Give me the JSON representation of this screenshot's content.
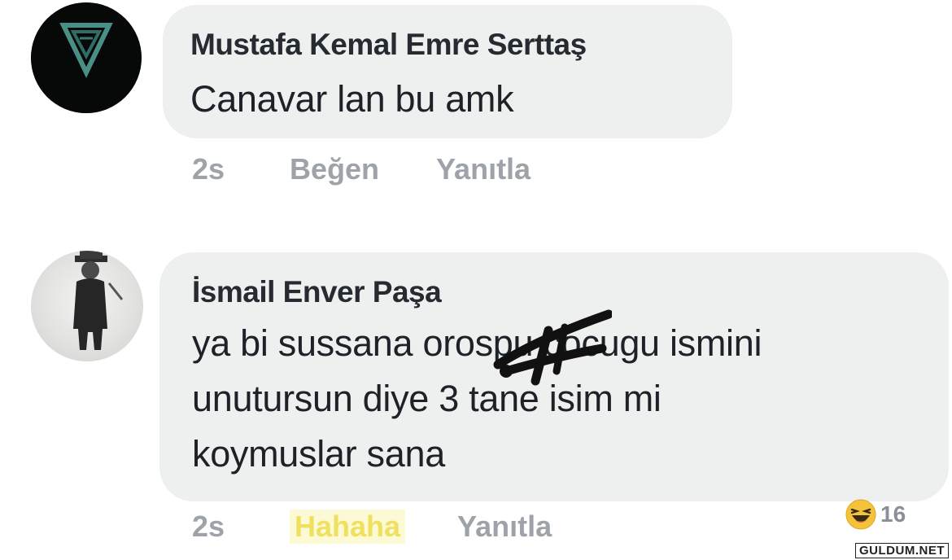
{
  "comments": [
    {
      "author": "Mustafa Kemal Emre Serttaş",
      "text_lines": [
        "Canavar lan bu amk"
      ],
      "time": "2s",
      "like_label": "Beğen",
      "reply_label": "Yanıtla"
    },
    {
      "author": "İsmail Enver Paşa",
      "text_lines": [
        "ya bi sussana orospu cocugu ismini",
        "unutursun diye 3 tane isim mi",
        "koymuslar sana"
      ],
      "time": "2s",
      "reaction_label": "Hahaha",
      "reply_label": "Yanıtla",
      "reaction_count": "16",
      "reaction_icon": "haha-emoji-icon"
    }
  ],
  "watermark": "GULDUM.NET",
  "colors": {
    "bubble": "#eeefef",
    "author": "#262a31",
    "meta": "#9ea3aa",
    "haha": "#f0e060"
  }
}
